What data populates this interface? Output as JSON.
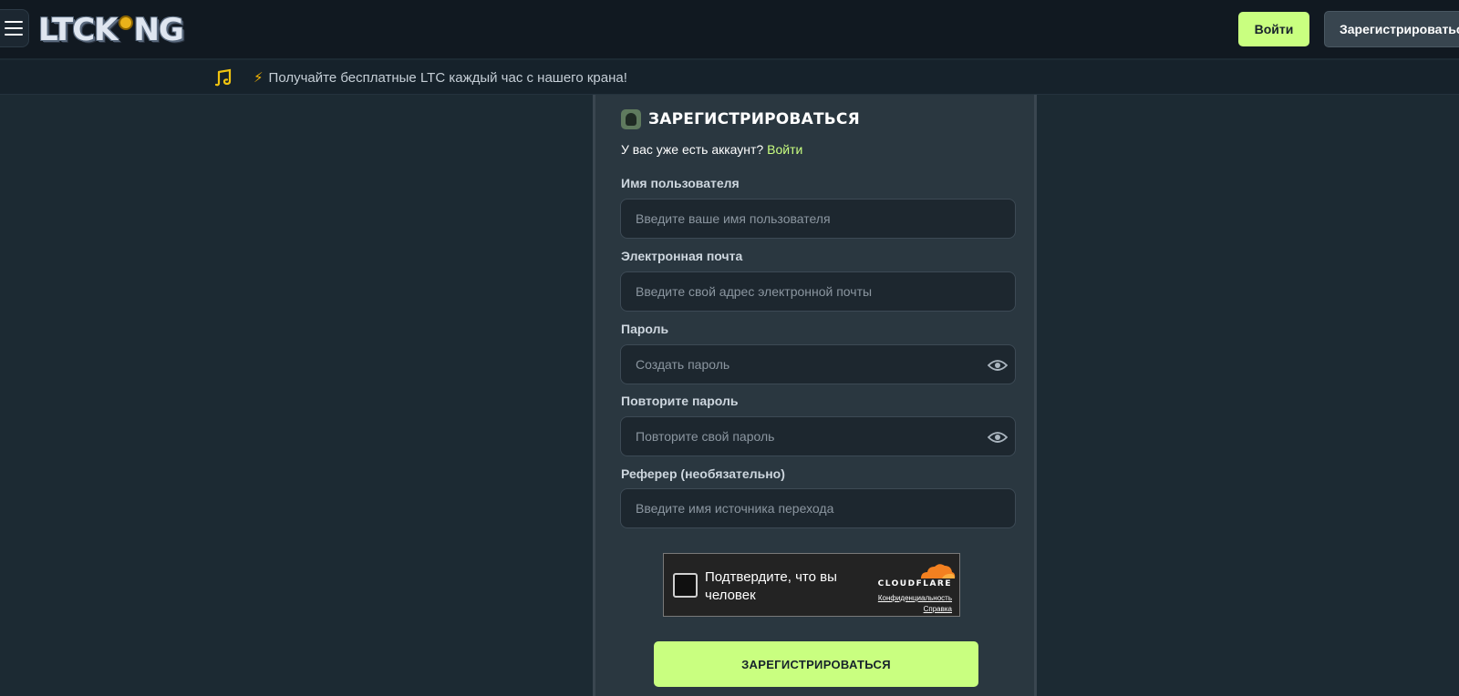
{
  "header": {
    "logo_text_before": "LTCK",
    "logo_text_after": "NG",
    "login_label": "Войти",
    "register_label": "Зарегистрироваться"
  },
  "promo": {
    "bolt": "⚡",
    "text": "Получайте бесплатные LTC каждый час с нашего крана!"
  },
  "form": {
    "title": "ЗАРЕГИСТРИРОВАТЬСЯ",
    "have_account_text": "У вас уже есть аккаунт?",
    "login_link": "Войти",
    "fields": [
      {
        "label": "Имя пользователя",
        "placeholder": "Введите ваше имя пользователя",
        "value": ""
      },
      {
        "label": "Электронная почта",
        "placeholder": "Введите свой адрес электронной почты",
        "value": ""
      },
      {
        "label": "Пароль",
        "placeholder": "Создать пароль",
        "value": ""
      },
      {
        "label": "Повторите пароль",
        "placeholder": "Повторите свой пароль",
        "value": ""
      },
      {
        "label": "Реферер (необязательно)",
        "placeholder": "Введите имя источника перехода",
        "value": ""
      }
    ],
    "submit_label": "ЗАРЕГИСТРИРОВАТЬСЯ"
  },
  "captcha": {
    "text": "Подтвердите, что вы человек",
    "brand": "CLOUDFLARE",
    "privacy_link": "Конфиденциальность",
    "help_link": "Справка"
  },
  "colors": {
    "accent": "#c9ff80",
    "page_bg": "#1c2a33",
    "header_bg": "#111921",
    "card_bg": "#2a3740",
    "cloudflare_orange": "#f38020"
  }
}
